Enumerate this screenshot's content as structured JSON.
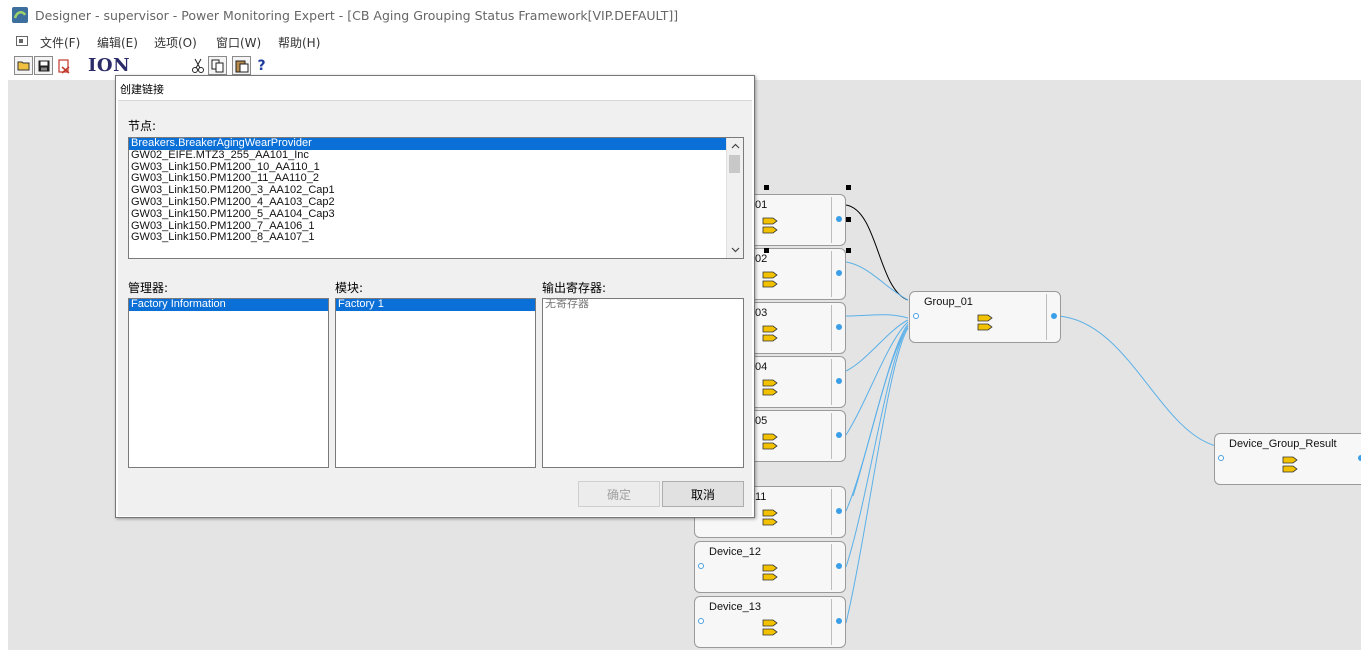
{
  "window": {
    "title": "Designer - supervisor - Power Monitoring Expert - [CB Aging Grouping Status Framework[VIP.DEFAULT]]"
  },
  "menu": {
    "items": [
      "文件(F)",
      "编辑(E)",
      "选项(O)",
      "窗口(W)",
      "帮助(H)"
    ]
  },
  "toolbar": {
    "logo_text": "ION",
    "buttons": [
      "open-icon",
      "save-icon",
      "exit-icon",
      "cut-icon",
      "copy-icon",
      "paste-icon",
      "help-icon"
    ]
  },
  "dialog": {
    "title": "创建链接",
    "node_label": "节点:",
    "nodes": [
      "Breakers.BreakerAgingWearProvider",
      "GW02_EIFE.MTZ3_255_AA101_Inc",
      "GW03_Link150.PM1200_10_AA110_1",
      "GW03_Link150.PM1200_11_AA110_2",
      "GW03_Link150.PM1200_3_AA102_Cap1",
      "GW03_Link150.PM1200_4_AA103_Cap2",
      "GW03_Link150.PM1200_5_AA104_Cap3",
      "GW03_Link150.PM1200_7_AA106_1",
      "GW03_Link150.PM1200_8_AA107_1"
    ],
    "manager_label": "管理器:",
    "managers": [
      "Factory Information"
    ],
    "module_label": "模块:",
    "modules": [
      "Factory 1"
    ],
    "register_label": "输出寄存器:",
    "registers": [
      "无寄存器"
    ],
    "ok_label": "确定",
    "cancel_label": "取消"
  },
  "canvas": {
    "nodes": [
      {
        "id": "d1",
        "label": "01"
      },
      {
        "id": "d2",
        "label": "02"
      },
      {
        "id": "d3",
        "label": "03"
      },
      {
        "id": "d4",
        "label": "04"
      },
      {
        "id": "d5",
        "label": "05"
      },
      {
        "id": "d11",
        "label": "11"
      },
      {
        "id": "d12",
        "label": "Device_12"
      },
      {
        "id": "d13",
        "label": "Device_13"
      },
      {
        "id": "g1",
        "label": "Group_01"
      },
      {
        "id": "res",
        "label": "Device_Group_Result"
      }
    ],
    "colors": {
      "wire": "#5ab0e8",
      "selected_wire": "#000000",
      "gate": "#f2c200",
      "port": "#3a9ee8"
    }
  }
}
